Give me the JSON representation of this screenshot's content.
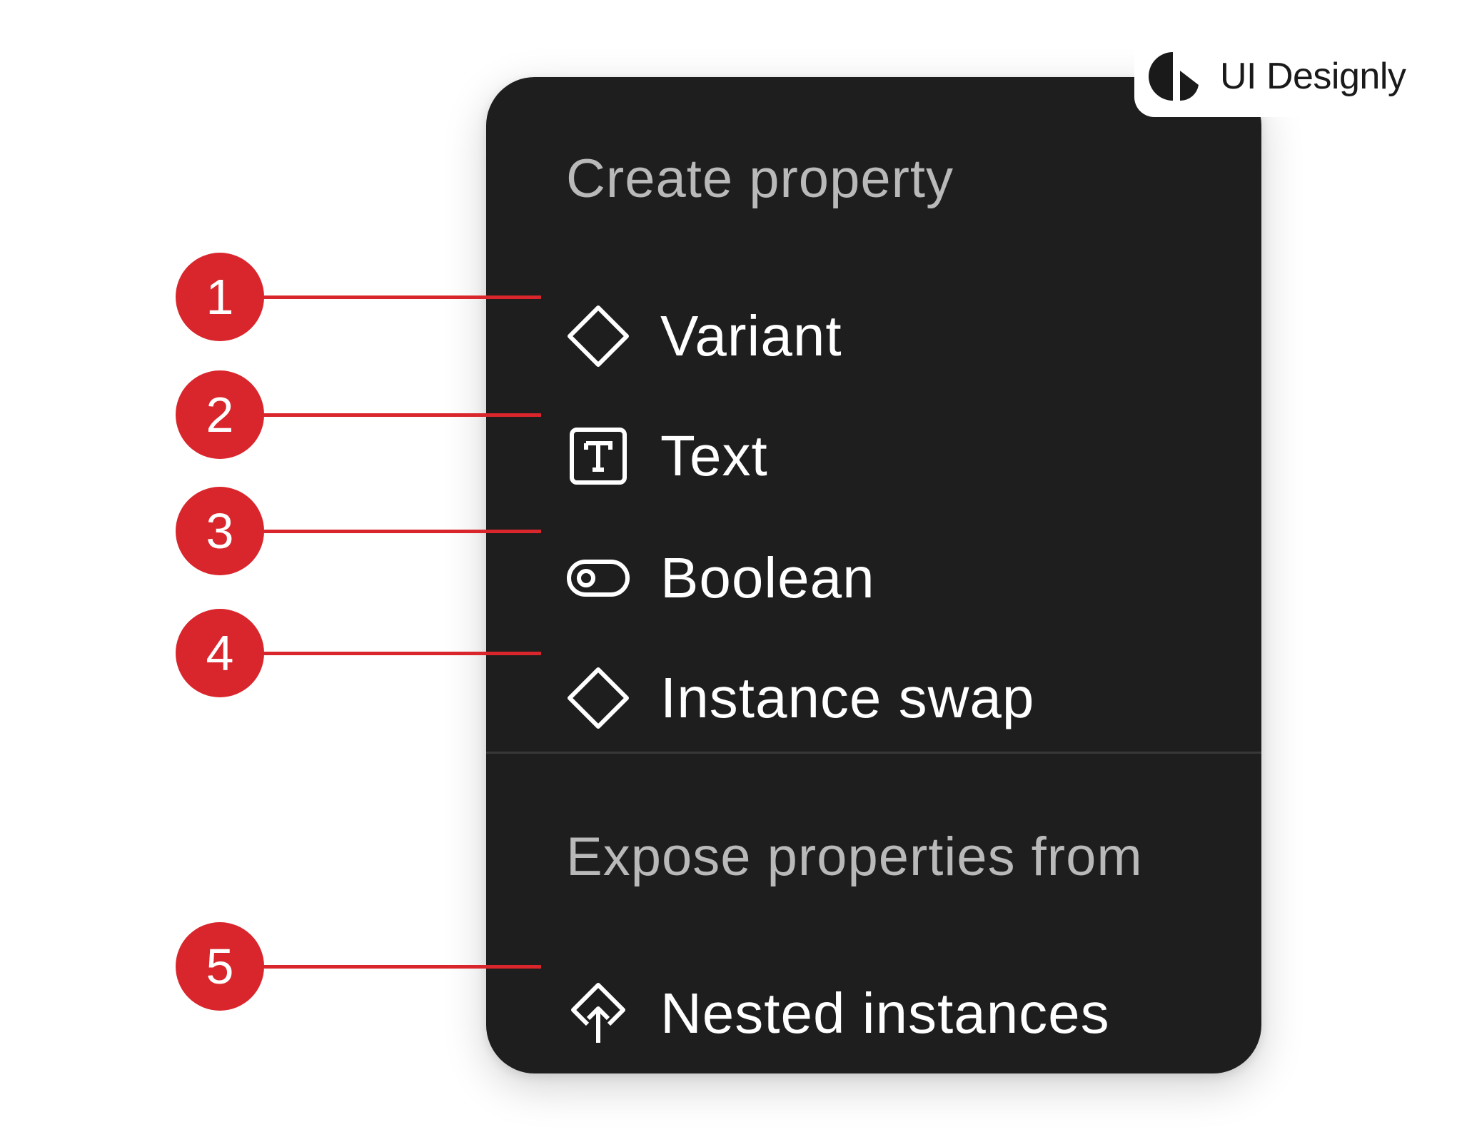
{
  "brand": {
    "name": "UI Designly",
    "logo_icon": "half-circle-logo-icon"
  },
  "menu": {
    "create_title": "Create property",
    "items": [
      {
        "label": "Variant",
        "icon": "diamond-icon"
      },
      {
        "label": "Text",
        "icon": "text-box-icon"
      },
      {
        "label": "Boolean",
        "icon": "toggle-icon"
      },
      {
        "label": "Instance swap",
        "icon": "diamond-icon"
      }
    ],
    "expose_title": "Expose properties from",
    "nested": {
      "label": "Nested instances",
      "icon": "diamond-arrow-up-icon"
    }
  },
  "callouts": [
    "1",
    "2",
    "3",
    "4",
    "5"
  ],
  "colors": {
    "menu_background": "#1e1e1e",
    "menu_text": "#ffffff",
    "section_title": "#b9b9b9",
    "callout": "#d9262c"
  }
}
